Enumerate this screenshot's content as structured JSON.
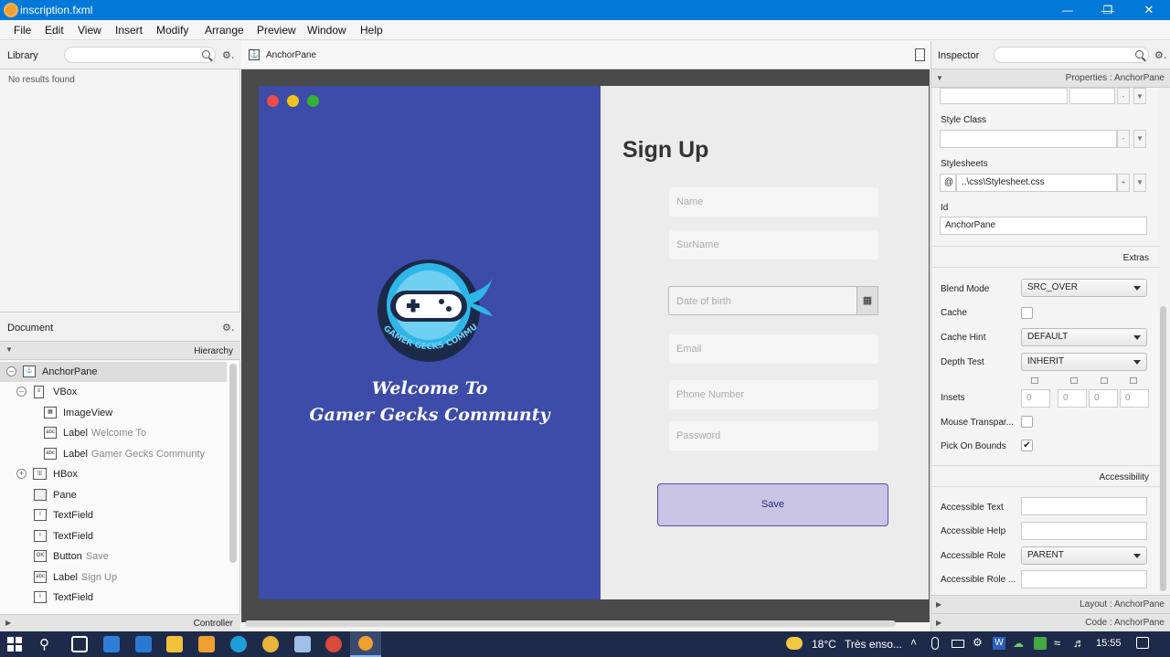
{
  "window": {
    "title": "inscription.fxml",
    "min": "—",
    "max": "❐",
    "close": "✕"
  },
  "menu": [
    "File",
    "Edit",
    "View",
    "Insert",
    "Modify",
    "Arrange",
    "Preview",
    "Window",
    "Help"
  ],
  "library": {
    "title": "Library",
    "empty_text": "No results found"
  },
  "document": {
    "title": "Document",
    "hierarchy_label": "Hierarchy",
    "controller_label": "Controller",
    "tree": [
      {
        "label": "AnchorPane",
        "sub": ""
      },
      {
        "label": "VBox",
        "sub": ""
      },
      {
        "label": "ImageView",
        "sub": ""
      },
      {
        "label": "Label",
        "sub": "Welcome To"
      },
      {
        "label": "Label",
        "sub": "Gamer Gecks Communty"
      },
      {
        "label": "HBox",
        "sub": ""
      },
      {
        "label": "Pane",
        "sub": ""
      },
      {
        "label": "TextField",
        "sub": ""
      },
      {
        "label": "TextField",
        "sub": ""
      },
      {
        "label": "Button",
        "sub": "Save"
      },
      {
        "label": "Label",
        "sub": "Sign Up"
      },
      {
        "label": "TextField",
        "sub": ""
      }
    ]
  },
  "breadcrumb": "AnchorPane",
  "form": {
    "title": "Sign Up",
    "welcome_line1": "Welcome To",
    "welcome_line2": "Gamer Gecks Communty",
    "logo_text": "GAMER GECKS COMMUNITY",
    "fields": {
      "name": "Name",
      "surname": "SurName",
      "dob": "Date of birth",
      "email": "Email",
      "phone": "Phone Number",
      "password": "Password"
    },
    "save": "Save"
  },
  "inspector": {
    "title": "Inspector",
    "properties_section": "Properties",
    "properties_target": "AnchorPane",
    "style_class_label": "Style Class",
    "stylesheets_label": "Stylesheets",
    "stylesheet_at": "@",
    "stylesheet_value": "..\\css\\Stylesheet.css",
    "id_label": "Id",
    "id_value": "AnchorPane",
    "extras_label": "Extras",
    "blend_mode_label": "Blend Mode",
    "blend_mode_value": "SRC_OVER",
    "cache_label": "Cache",
    "cache_hint_label": "Cache Hint",
    "cache_hint_value": "DEFAULT",
    "depth_test_label": "Depth Test",
    "depth_test_value": "INHERIT",
    "insets_label": "Insets",
    "insets_values": [
      "0",
      "0",
      "0",
      "0"
    ],
    "mouse_transparent_label": "Mouse Transpar...",
    "pick_on_bounds_label": "Pick On Bounds",
    "pick_on_bounds_checked": "✔",
    "accessibility_label": "Accessibility",
    "accessible_text_label": "Accessible Text",
    "accessible_help_label": "Accessible Help",
    "accessible_role_label": "Accessible Role",
    "accessible_role_value": "PARENT",
    "accessible_role_desc_label": "Accessible Role ...",
    "layout_section": "Layout",
    "layout_target": "AnchorPane",
    "code_section": "Code",
    "code_target": "AnchorPane"
  },
  "taskbar": {
    "temperature": "18°C",
    "weather": "Très enso...",
    "time": "15:55"
  },
  "colors": {
    "titlebar": "#0078d7",
    "left_pane": "#3c4ca8",
    "save_button": "#c9c3e4",
    "save_border": "#5a4cb8"
  }
}
